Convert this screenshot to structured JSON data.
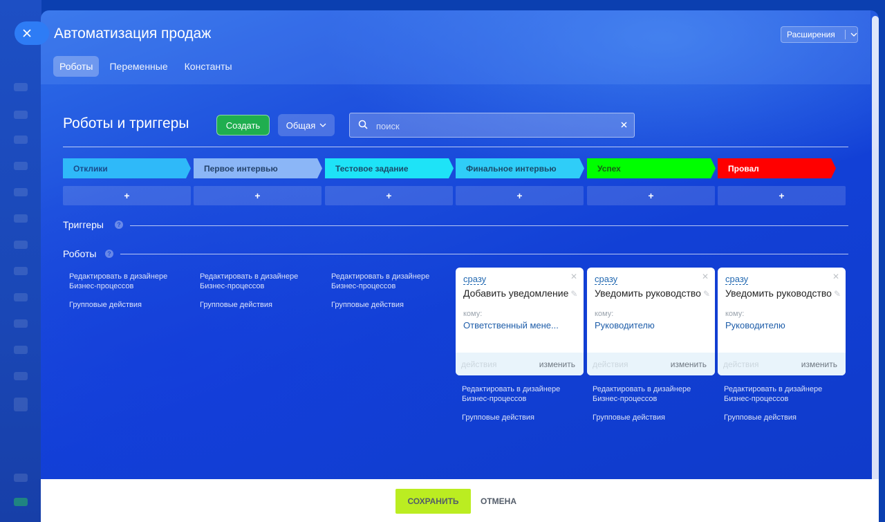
{
  "window": {
    "title": "Автоматизация продаж",
    "extensions_label": "Расширения",
    "tabs": [
      {
        "label": "Роботы",
        "active": true
      },
      {
        "label": "Переменные",
        "active": false
      },
      {
        "label": "Константы",
        "active": false
      }
    ]
  },
  "toolbar": {
    "page_title": "Роботы и триггеры",
    "create_label": "Создать",
    "general_label": "Общая",
    "search_placeholder": "поиск"
  },
  "stages": [
    {
      "label": "Отклики",
      "color": "#2fb9f9",
      "text_color": "#1a4b8a"
    },
    {
      "label": "Первое интервью",
      "color": "#8bb6f7",
      "text_color": "#24436b"
    },
    {
      "label": "Тестовое задание",
      "color": "#1ee3f7",
      "text_color": "#1a4b6a"
    },
    {
      "label": "Финальное интервью",
      "color": "#2fcdf8",
      "text_color": "#1a4b6a"
    },
    {
      "label": "Успех",
      "color": "#00ff00",
      "text_color": "#1a5a1a"
    },
    {
      "label": "Провал",
      "color": "#ff0000",
      "text_color": "#ffffff"
    }
  ],
  "add_symbol": "+",
  "sections": {
    "triggers": "Триггеры",
    "robots": "Роботы",
    "help_symbol": "?"
  },
  "links": {
    "edit_in_designer": "Редактировать в дизайнере Бизнес-процессов",
    "group_actions": "Групповые действия"
  },
  "robot_cards": [
    {
      "when": "сразу",
      "name": "Добавить уведомление",
      "whom_label": "кому:",
      "to": "Ответственный мене...",
      "actions": "действия",
      "change": "изменить"
    },
    {
      "when": "сразу",
      "name": "Уведомить руководство",
      "whom_label": "кому:",
      "to": "Руководителю",
      "actions": "действия",
      "change": "изменить"
    },
    {
      "when": "сразу",
      "name": "Уведомить руководство",
      "whom_label": "кому:",
      "to": "Руководителю",
      "actions": "действия",
      "change": "изменить"
    }
  ],
  "footer": {
    "save_label": "СОХРАНИТЬ",
    "cancel_label": "ОТМЕНА"
  }
}
